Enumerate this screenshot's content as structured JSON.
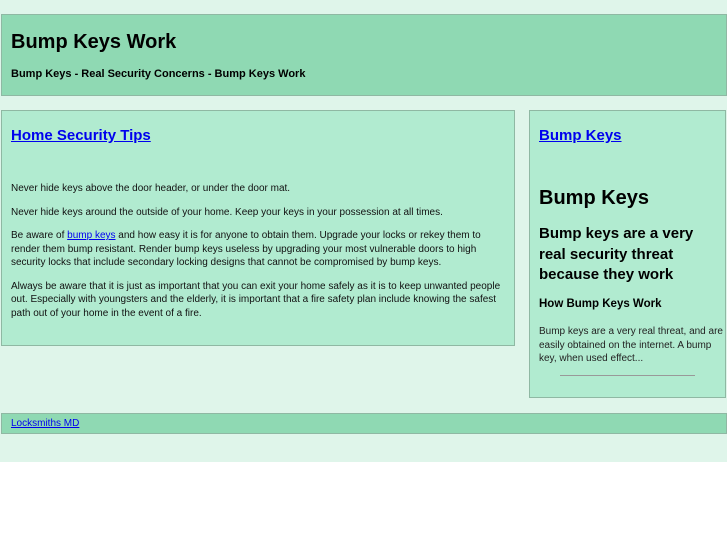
{
  "header": {
    "title": "Bump Keys Work",
    "subtitle": "Bump Keys - Real Security Concerns - Bump Keys Work"
  },
  "main": {
    "heading": "Home Security Tips",
    "p1": "Never hide keys above the door header, or under the door mat.",
    "p2": "Never hide keys around the outside of your home. Keep your keys in your possession at all times.",
    "p3_before": "Be aware of ",
    "p3_link": "bump keys",
    "p3_after": " and how easy it is for anyone to obtain them. Upgrade your locks or rekey them to render them bump resistant. Render bump keys useless by upgrading your most vulnerable doors to high security locks that include secondary locking designs that cannot be compromised by bump keys.",
    "p4": "Always be aware that it is just as important that you can exit your home safely as it is to keep unwanted people out. Especially with youngsters and the elderly, it is important that a fire safety plan include knowing the safest path out of your home in the event of a fire."
  },
  "sidebar": {
    "link": "Bump Keys",
    "heading": "Bump Keys",
    "subheading": "Bump keys are a very real security threat because they work",
    "article_title": "How Bump Keys Work",
    "excerpt": "Bump keys are a very real threat, and are easily obtained on the internet. A bump key, when used effect..."
  },
  "footer": {
    "link": "Locksmiths MD"
  }
}
